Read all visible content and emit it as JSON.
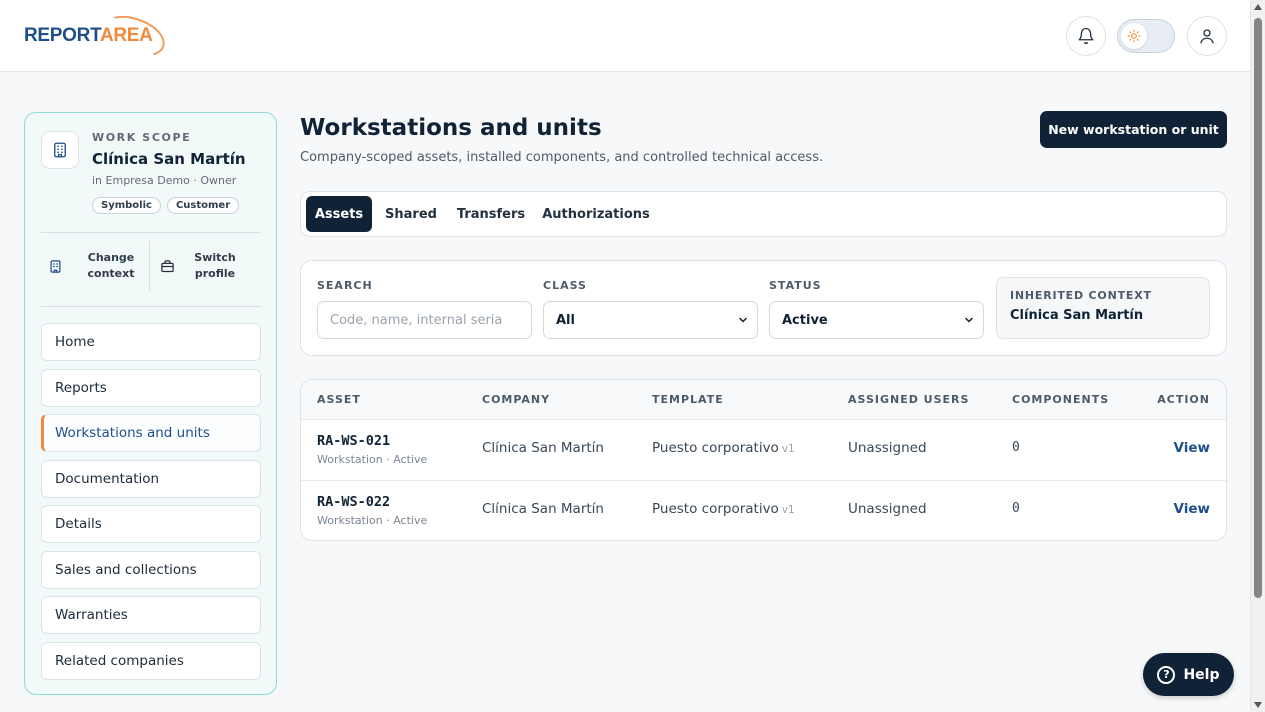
{
  "brand": {
    "part1": "REPORT",
    "part2": "AREA",
    "primary": "#1f4f8a",
    "accent": "#f08a3c",
    "dark": "#0f2236",
    "sidebar_border": "#8fdcd3"
  },
  "header": {
    "icons": [
      "bell-icon",
      "sun-icon",
      "user-icon"
    ]
  },
  "sidebar": {
    "scope_label": "WORK SCOPE",
    "scope_name": "Clínica San Martín",
    "scope_sub": "in Empresa Demo · Owner",
    "chips": [
      "Symbolic",
      "Customer"
    ],
    "change_context": "Change\ncontext",
    "switch_profile": "Switch\nprofile",
    "items": [
      {
        "label": "Home"
      },
      {
        "label": "Reports"
      },
      {
        "label": "Workstations and units",
        "active": true
      },
      {
        "label": "Documentation"
      },
      {
        "label": "Details"
      },
      {
        "label": "Sales and collections"
      },
      {
        "label": "Warranties"
      },
      {
        "label": "Related companies"
      }
    ]
  },
  "main": {
    "title": "Workstations and units",
    "subtitle": "Company-scoped assets, installed components, and controlled technical access.",
    "new_button": "New workstation or unit",
    "tabs": [
      {
        "label": "Assets",
        "active": true
      },
      {
        "label": "Shared"
      },
      {
        "label": "Transfers"
      },
      {
        "label": "Authorizations"
      }
    ],
    "filters": {
      "search_label": "SEARCH",
      "search_placeholder": "Code, name, internal seria",
      "class_label": "CLASS",
      "class_value": "All",
      "status_label": "STATUS",
      "status_value": "Active",
      "inherited_label": "INHERITED CONTEXT",
      "inherited_value": "Clínica San Martín"
    },
    "table": {
      "headers": [
        "ASSET",
        "COMPANY",
        "TEMPLATE",
        "ASSIGNED USERS",
        "COMPONENTS",
        "ACTION"
      ],
      "rows": [
        {
          "code": "RA-WS-021",
          "meta": "Workstation · Active",
          "company": "Clínica San Martín",
          "template": "Puesto corporativo",
          "version": "v1",
          "users": "Unassigned",
          "components": "0",
          "action": "View"
        },
        {
          "code": "RA-WS-022",
          "meta": "Workstation · Active",
          "company": "Clínica San Martín",
          "template": "Puesto corporativo",
          "version": "v1",
          "users": "Unassigned",
          "components": "0",
          "action": "View"
        }
      ]
    }
  },
  "help": {
    "label": "Help"
  }
}
